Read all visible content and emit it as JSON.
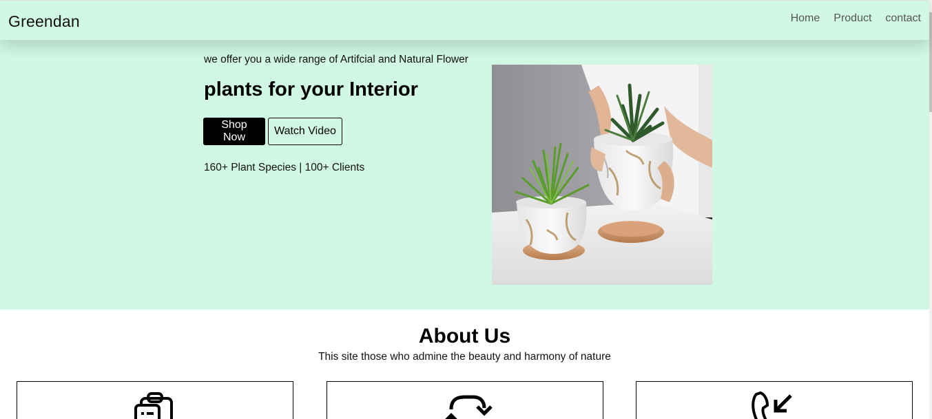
{
  "nav": {
    "brand": "Greendan",
    "links": [
      "Home",
      "Product",
      "contact"
    ]
  },
  "hero": {
    "tagline": "we offer you a wide range of Artifcial and Natural Flower",
    "headline": "plants for your Interior",
    "shop_label": "Shop Now",
    "watch_label": "Watch Video",
    "stats": "160+ Plant Species | 100+ Clients",
    "image_icon": "potted-plants-photo"
  },
  "about": {
    "title": "About Us",
    "subtitle": "This site those who admine the beauty and harmony of nature",
    "cards": [
      {
        "icon": "clipboard-icon"
      },
      {
        "icon": "refresh-arrows-icon"
      },
      {
        "icon": "phone-incoming-icon"
      }
    ]
  },
  "colors": {
    "mint_background": "#d0f8e4",
    "button_primary": "#000000",
    "nav_link": "#555555"
  }
}
